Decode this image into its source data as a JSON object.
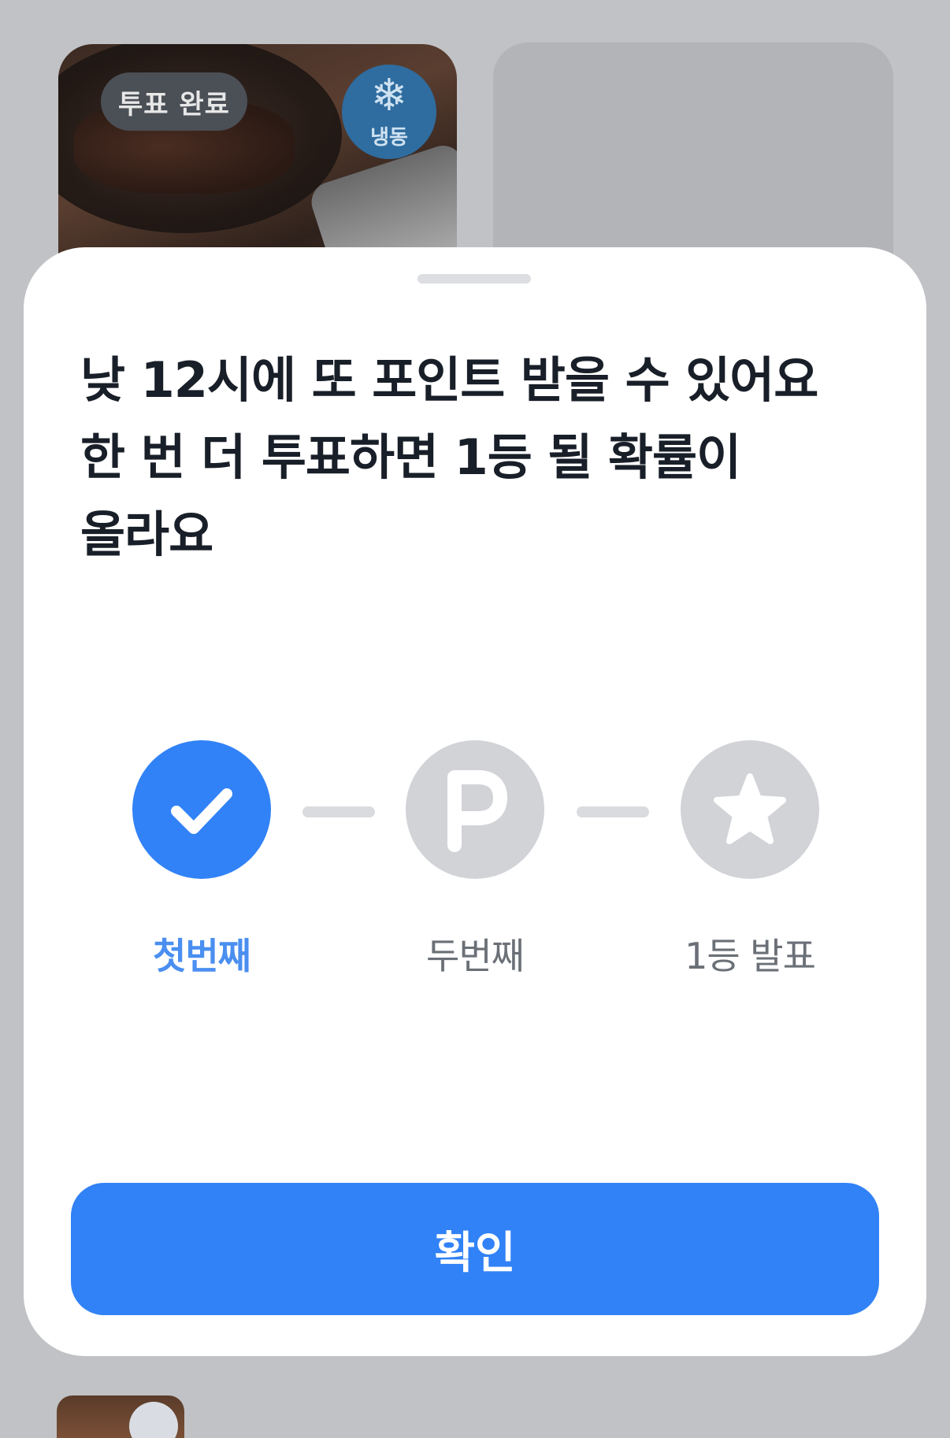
{
  "background": {
    "card": {
      "vote_badge": "투표 완료",
      "frozen_badge": "냉동",
      "frozen_icon": "snowflake-icon"
    }
  },
  "sheet": {
    "title_lines": [
      "낮 12시에 또 포인트 받을 수 있어요",
      "한 번 더 투표하면 1등 될 확률이",
      "올라요"
    ],
    "steps": [
      {
        "label": "첫번째",
        "icon": "check-icon",
        "state": "done"
      },
      {
        "label": "두번째",
        "icon": "point-icon",
        "state": "pending"
      },
      {
        "label": "1등 발표",
        "icon": "star-icon",
        "state": "pending"
      }
    ],
    "confirm_label": "확인"
  },
  "colors": {
    "accent": "#3182f6",
    "pending": "#d1d3d7",
    "title": "#191f28"
  }
}
